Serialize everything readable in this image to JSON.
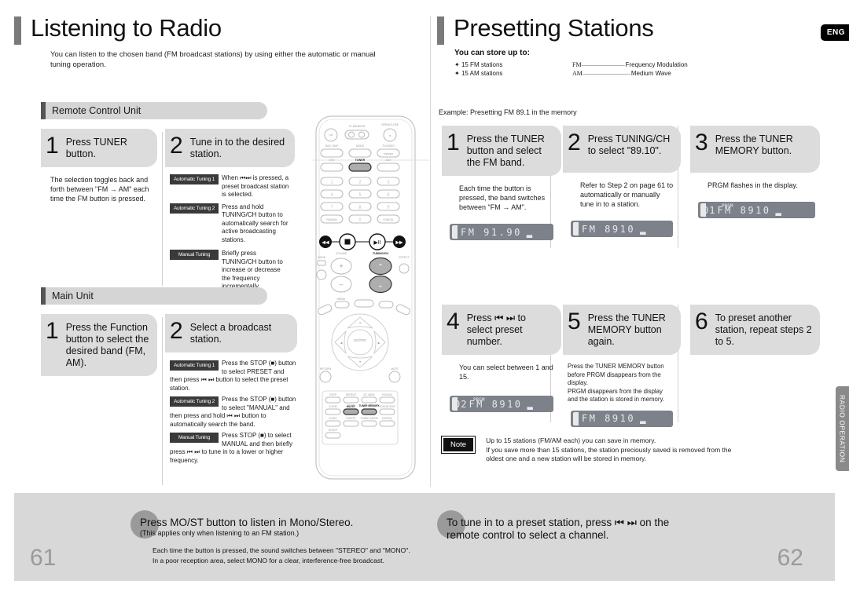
{
  "language_badge": "ENG",
  "side_tab": "RADIO OPERATION",
  "left_page": {
    "title": "Listening to Radio",
    "intro": "You can listen to the chosen band (FM broadcast stations) by using either the automatic or manual tuning operation.",
    "page_number": "61",
    "sections": [
      {
        "header": "Remote Control Unit",
        "steps": [
          {
            "number": "1",
            "title": "Press TUNER button.",
            "body": "The selection toggles back and forth between \"FM → AM\" each time the FM button is pressed."
          },
          {
            "number": "2",
            "title": "Tune in to the desired station.",
            "modes": [
              {
                "badge": "Automatic Tuning 1",
                "text": "When ⏮⏭ is pressed, a preset broadcast station is selected."
              },
              {
                "badge": "Automatic Tuning 2",
                "text": "Press and hold TUNING/CH button to automatically search for active broadcasting stations."
              },
              {
                "badge": "Manual Tuning",
                "text": "Briefly press TUNING/CH button to increase or decrease the frequency incrementally."
              }
            ]
          }
        ]
      },
      {
        "header": "Main Unit",
        "steps": [
          {
            "number": "1",
            "title": "Press the Function button to select the desired band (FM, AM).",
            "body": ""
          },
          {
            "number": "2",
            "title": "Select a broadcast station.",
            "modes": [
              {
                "badge": "Automatic Tuning 1",
                "text": "Press the STOP (■) button to select PRESET and then press ⏮ ⏭ button to select the preset station."
              },
              {
                "badge": "Automatic Tuning 2",
                "text": "Press the STOP (■) button to select \"MANUAL\" and then press and hold ⏮ ⏭ button to automatically search the band."
              },
              {
                "badge": "Manual Tuning",
                "text": "Press STOP (■) to select MANUAL and then briefly press ⏮ ⏭ to tune in to a lower or higher frequency."
              }
            ]
          }
        ]
      }
    ],
    "footer": {
      "heading": "Press MO/ST button to listen in Mono/Stereo.",
      "subheading": "(This applies only when listening to an FM station.)",
      "lines": [
        "Each time the button is pressed, the sound switches between \"STEREO\" and \"MONO\".",
        "In a poor reception area, select MONO for a clear, interference-free broadcast."
      ]
    }
  },
  "right_page": {
    "title": "Presetting Stations",
    "store_heading": "You can store up to:",
    "store_items": [
      "15 FM stations",
      "15 AM stations"
    ],
    "abbreviations": [
      {
        "key": "FM",
        "dots": "––––––––––––––––––",
        "value": "Frequency Modulation"
      },
      {
        "key": "AM",
        "dots": "––––––––––––––––––––",
        "value": "Medium Wave"
      }
    ],
    "example": "Example: Presetting FM 89.1 in the memory",
    "page_number": "62",
    "steps": [
      {
        "number": "1",
        "title": "Press the TUNER button and select the FM band.",
        "body": "Each time the button is pressed, the band switches between \"FM → AM\".",
        "display": {
          "text": "FM 91.90",
          "preset": "",
          "prgm": ""
        }
      },
      {
        "number": "2",
        "title": "Press TUNING/CH to select \"89.10\".",
        "body": "Refer to Step 2 on page 61 to automatically or manually tune in to a station.",
        "display": {
          "text": "FM 8910",
          "preset": "",
          "prgm": ""
        }
      },
      {
        "number": "3",
        "title": "Press the TUNER MEMORY button.",
        "body": "PRGM  flashes in the display.",
        "display": {
          "text": "FM 8910",
          "preset": "01",
          "prgm": "PRGM"
        }
      },
      {
        "number": "4",
        "title": "Press ⏮ ⏭ to select preset number.",
        "body": "You can select between 1 and 15.",
        "display": {
          "text": "FM 8910",
          "preset": "02",
          "prgm": "PRGM"
        }
      },
      {
        "number": "5",
        "title": "Press the TUNER MEMORY button again.",
        "body": "Press the TUNER MEMORY button before PRGM  disappears from the display.\nPRGM  disappears from the display and the station is stored in memory.",
        "display": {
          "text": "FM 8910",
          "preset": "",
          "prgm": ""
        }
      },
      {
        "number": "6",
        "title": "To preset another station, repeat steps 2 to 5.",
        "body": "",
        "display": null
      }
    ],
    "note": {
      "badge": "Note",
      "lines": [
        "Up to 15 stations (FM/AM each) you can save in memory.",
        "If you save more than 15 stations, the station preciously saved is removed from the",
        "oldest one and  a new station will be stored in memory."
      ]
    },
    "footer": {
      "lines": [
        "To tune in to a preset station, press  ⏮ ⏭  on the",
        "remote control to select a channel."
      ]
    }
  },
  "remote": {
    "highlighted_buttons": [
      "TUNER",
      "TUNING/CH",
      "TUNER MEMORY",
      "MO/ST"
    ],
    "labels": {
      "power": "⏻/I",
      "tv_band": "TV BAND/SW",
      "open_close": "OPEN/CLOSE",
      "disc_skip": "DISC SKIP",
      "mode": "MODE",
      "tv_video": "TV/VIDEO",
      "dvd": "DVD",
      "tuner": "TUNER",
      "aux": "AUX",
      "remain": "REMAIN",
      "cancel": "CANCEL",
      "volume": "VOLUME",
      "tuning_ch": "TUNING/CH",
      "dolby_mode": "MODE",
      "dolby_effect": "EFFECT",
      "return": "RETURN",
      "mute": "MUTE",
      "enter": "ENTER",
      "tuner_memory": "TUNER MEMORY",
      "most": "MO/ST"
    },
    "numpad": [
      "1",
      "2",
      "3",
      "4",
      "5",
      "6",
      "7",
      "8",
      "9",
      "0"
    ]
  }
}
